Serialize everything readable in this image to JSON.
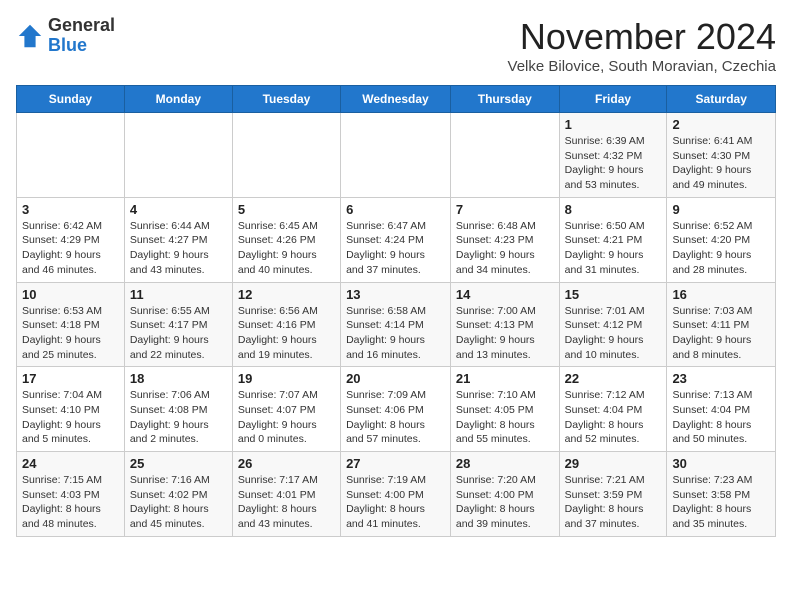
{
  "header": {
    "logo_general": "General",
    "logo_blue": "Blue",
    "month_year": "November 2024",
    "location": "Velke Bilovice, South Moravian, Czechia"
  },
  "columns": [
    "Sunday",
    "Monday",
    "Tuesday",
    "Wednesday",
    "Thursday",
    "Friday",
    "Saturday"
  ],
  "weeks": [
    [
      {
        "day": "",
        "info": ""
      },
      {
        "day": "",
        "info": ""
      },
      {
        "day": "",
        "info": ""
      },
      {
        "day": "",
        "info": ""
      },
      {
        "day": "",
        "info": ""
      },
      {
        "day": "1",
        "info": "Sunrise: 6:39 AM\nSunset: 4:32 PM\nDaylight: 9 hours and 53 minutes."
      },
      {
        "day": "2",
        "info": "Sunrise: 6:41 AM\nSunset: 4:30 PM\nDaylight: 9 hours and 49 minutes."
      }
    ],
    [
      {
        "day": "3",
        "info": "Sunrise: 6:42 AM\nSunset: 4:29 PM\nDaylight: 9 hours and 46 minutes."
      },
      {
        "day": "4",
        "info": "Sunrise: 6:44 AM\nSunset: 4:27 PM\nDaylight: 9 hours and 43 minutes."
      },
      {
        "day": "5",
        "info": "Sunrise: 6:45 AM\nSunset: 4:26 PM\nDaylight: 9 hours and 40 minutes."
      },
      {
        "day": "6",
        "info": "Sunrise: 6:47 AM\nSunset: 4:24 PM\nDaylight: 9 hours and 37 minutes."
      },
      {
        "day": "7",
        "info": "Sunrise: 6:48 AM\nSunset: 4:23 PM\nDaylight: 9 hours and 34 minutes."
      },
      {
        "day": "8",
        "info": "Sunrise: 6:50 AM\nSunset: 4:21 PM\nDaylight: 9 hours and 31 minutes."
      },
      {
        "day": "9",
        "info": "Sunrise: 6:52 AM\nSunset: 4:20 PM\nDaylight: 9 hours and 28 minutes."
      }
    ],
    [
      {
        "day": "10",
        "info": "Sunrise: 6:53 AM\nSunset: 4:18 PM\nDaylight: 9 hours and 25 minutes."
      },
      {
        "day": "11",
        "info": "Sunrise: 6:55 AM\nSunset: 4:17 PM\nDaylight: 9 hours and 22 minutes."
      },
      {
        "day": "12",
        "info": "Sunrise: 6:56 AM\nSunset: 4:16 PM\nDaylight: 9 hours and 19 minutes."
      },
      {
        "day": "13",
        "info": "Sunrise: 6:58 AM\nSunset: 4:14 PM\nDaylight: 9 hours and 16 minutes."
      },
      {
        "day": "14",
        "info": "Sunrise: 7:00 AM\nSunset: 4:13 PM\nDaylight: 9 hours and 13 minutes."
      },
      {
        "day": "15",
        "info": "Sunrise: 7:01 AM\nSunset: 4:12 PM\nDaylight: 9 hours and 10 minutes."
      },
      {
        "day": "16",
        "info": "Sunrise: 7:03 AM\nSunset: 4:11 PM\nDaylight: 9 hours and 8 minutes."
      }
    ],
    [
      {
        "day": "17",
        "info": "Sunrise: 7:04 AM\nSunset: 4:10 PM\nDaylight: 9 hours and 5 minutes."
      },
      {
        "day": "18",
        "info": "Sunrise: 7:06 AM\nSunset: 4:08 PM\nDaylight: 9 hours and 2 minutes."
      },
      {
        "day": "19",
        "info": "Sunrise: 7:07 AM\nSunset: 4:07 PM\nDaylight: 9 hours and 0 minutes."
      },
      {
        "day": "20",
        "info": "Sunrise: 7:09 AM\nSunset: 4:06 PM\nDaylight: 8 hours and 57 minutes."
      },
      {
        "day": "21",
        "info": "Sunrise: 7:10 AM\nSunset: 4:05 PM\nDaylight: 8 hours and 55 minutes."
      },
      {
        "day": "22",
        "info": "Sunrise: 7:12 AM\nSunset: 4:04 PM\nDaylight: 8 hours and 52 minutes."
      },
      {
        "day": "23",
        "info": "Sunrise: 7:13 AM\nSunset: 4:04 PM\nDaylight: 8 hours and 50 minutes."
      }
    ],
    [
      {
        "day": "24",
        "info": "Sunrise: 7:15 AM\nSunset: 4:03 PM\nDaylight: 8 hours and 48 minutes."
      },
      {
        "day": "25",
        "info": "Sunrise: 7:16 AM\nSunset: 4:02 PM\nDaylight: 8 hours and 45 minutes."
      },
      {
        "day": "26",
        "info": "Sunrise: 7:17 AM\nSunset: 4:01 PM\nDaylight: 8 hours and 43 minutes."
      },
      {
        "day": "27",
        "info": "Sunrise: 7:19 AM\nSunset: 4:00 PM\nDaylight: 8 hours and 41 minutes."
      },
      {
        "day": "28",
        "info": "Sunrise: 7:20 AM\nSunset: 4:00 PM\nDaylight: 8 hours and 39 minutes."
      },
      {
        "day": "29",
        "info": "Sunrise: 7:21 AM\nSunset: 3:59 PM\nDaylight: 8 hours and 37 minutes."
      },
      {
        "day": "30",
        "info": "Sunrise: 7:23 AM\nSunset: 3:58 PM\nDaylight: 8 hours and 35 minutes."
      }
    ]
  ]
}
